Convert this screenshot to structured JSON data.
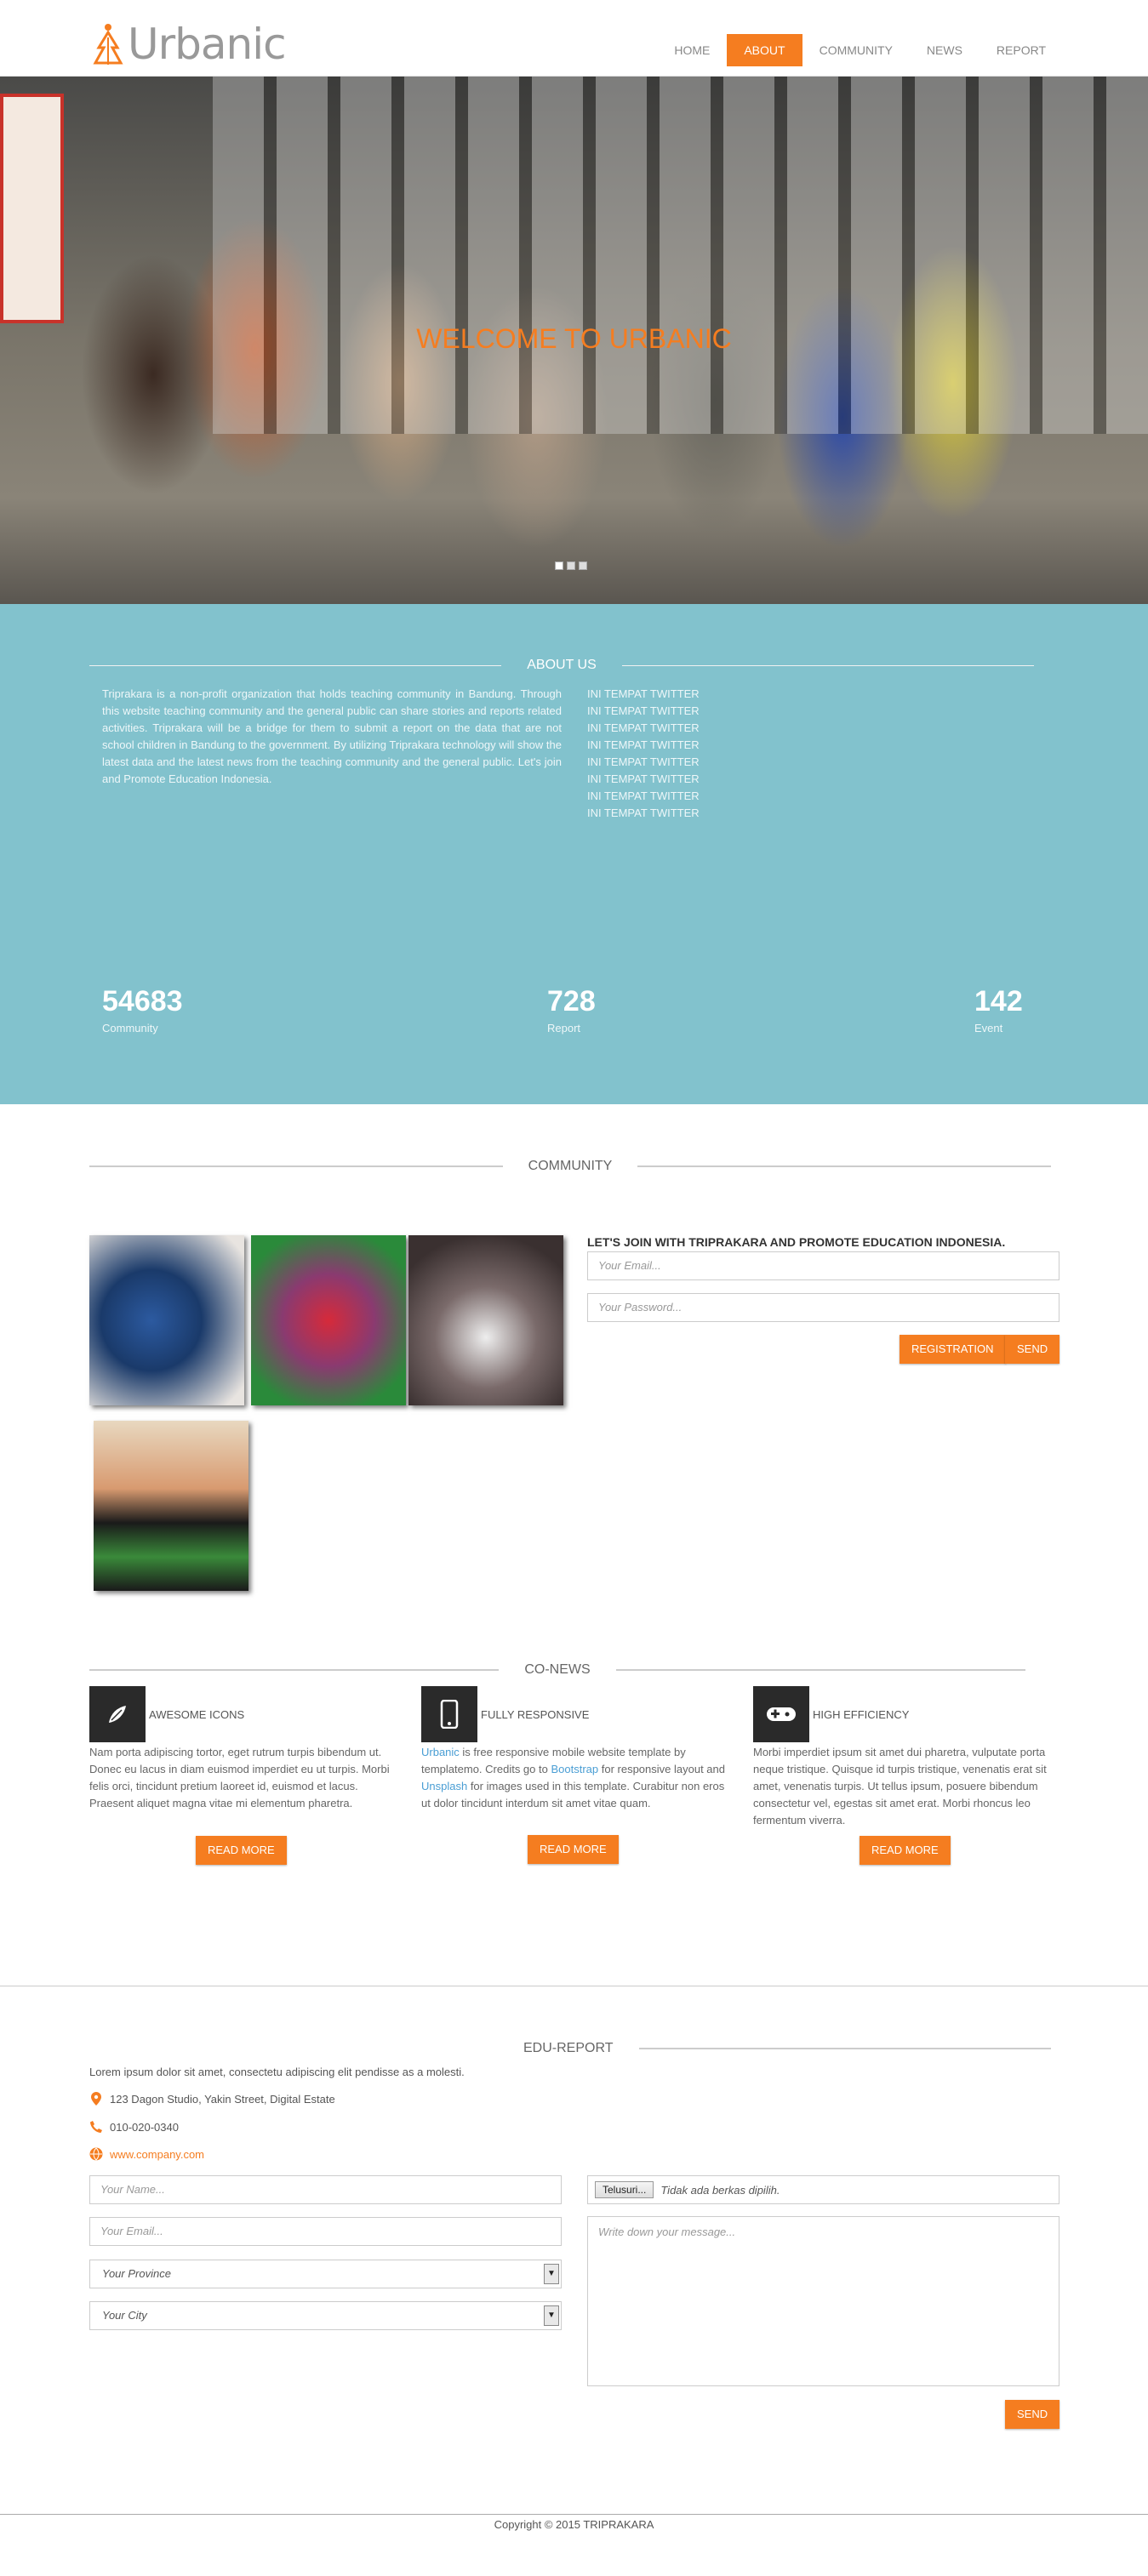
{
  "brand": {
    "name": "Urbanic",
    "accent": "#f57d20",
    "about_bg": "#82c2cd"
  },
  "nav": {
    "items": [
      {
        "label": "HOME",
        "active": false
      },
      {
        "label": "ABOUT",
        "active": true
      },
      {
        "label": "COMMUNITY",
        "active": false
      },
      {
        "label": "NEWS",
        "active": false
      },
      {
        "label": "REPORT",
        "active": false
      }
    ]
  },
  "hero": {
    "title": "WELCOME TO URBANIC",
    "slides": 3,
    "active_slide": 1
  },
  "about": {
    "title": "ABOUT US",
    "text": "Triprakara is a non-profit organization that holds teaching community in Bandung. Through this website teaching community and the general public can share stories and reports related activities. Triprakara will be a bridge for them to submit a report on the data that are not school children in Bandung to the government. By utilizing Triprakara technology will show the latest data and the latest news from the teaching community and the general public. Let's join and Promote Education Indonesia.",
    "twitter": [
      "INI TEMPAT TWITTER",
      "INI TEMPAT TWITTER",
      "INI TEMPAT TWITTER",
      "INI TEMPAT TWITTER",
      "INI TEMPAT TWITTER",
      "INI TEMPAT TWITTER",
      "INI TEMPAT TWITTER",
      "INI TEMPAT TWITTER"
    ],
    "stats": [
      {
        "num": "54683",
        "label": "Community"
      },
      {
        "num": "728",
        "label": "Report"
      },
      {
        "num": "142",
        "label": "Event"
      }
    ]
  },
  "community": {
    "title": "COMMUNITY",
    "join_heading": "LET'S JOIN WITH TRIPRAKARA AND PROMOTE EDUCATION INDONESIA.",
    "email_placeholder": "Your Email...",
    "password_placeholder": "Your Password...",
    "registration_label": "REGISTRATION",
    "send_label": "SEND"
  },
  "conews": {
    "title": "CO-NEWS",
    "items": [
      {
        "icon": "leaf-icon",
        "title": "AWESOME ICONS",
        "body": "Nam porta adipiscing tortor, eget rutrum turpis bibendum ut. Donec eu lacus in diam euismod imperdiet eu ut turpis. Morbi felis orci, tincidunt pretium laoreet id, euismod et lacus. Praesent aliquet magna vitae mi elementum pharetra.",
        "button": "READ MORE"
      },
      {
        "icon": "mobile-icon",
        "title": "FULLY RESPONSIVE",
        "body_parts": [
          "Urbanic",
          " is free responsive mobile website template by templatemo. Credits go to ",
          "Bootstrap",
          " for responsive layout and ",
          "Unsplash",
          " for images used in this template. Curabitur non eros ut dolor tincidunt interdum sit amet vitae quam."
        ],
        "button": "READ MORE"
      },
      {
        "icon": "gamepad-icon",
        "title": "HIGH EFFICIENCY",
        "body": "Morbi imperdiet ipsum sit amet dui pharetra, vulputate porta neque tristique. Quisque id turpis tristique, venenatis erat sit amet, venenatis turpis. Ut tellus ipsum, posuere bibendum consectetur vel, egestas sit amet erat. Morbi rhoncus leo fermentum viverra.",
        "button": "READ MORE"
      }
    ]
  },
  "edu": {
    "title": "EDU-REPORT",
    "intro": "Lorem ipsum dolor sit amet, consectetu adipiscing elit pendisse as a molesti.",
    "address": "123 Dagon Studio, Yakin Street, Digital Estate",
    "phone": "010-020-0340",
    "website": "www.company.com",
    "name_placeholder": "Your Name...",
    "email_placeholder": "Your Email...",
    "province_selected": "Your Province",
    "city_selected": "Your City",
    "file_button": "Telusuri...",
    "file_status": "Tidak ada berkas dipilih.",
    "message_placeholder": "Write down your message...",
    "send_label": "SEND"
  },
  "footer": {
    "copyright": "Copyright © 2015 TRIPRAKARA"
  }
}
